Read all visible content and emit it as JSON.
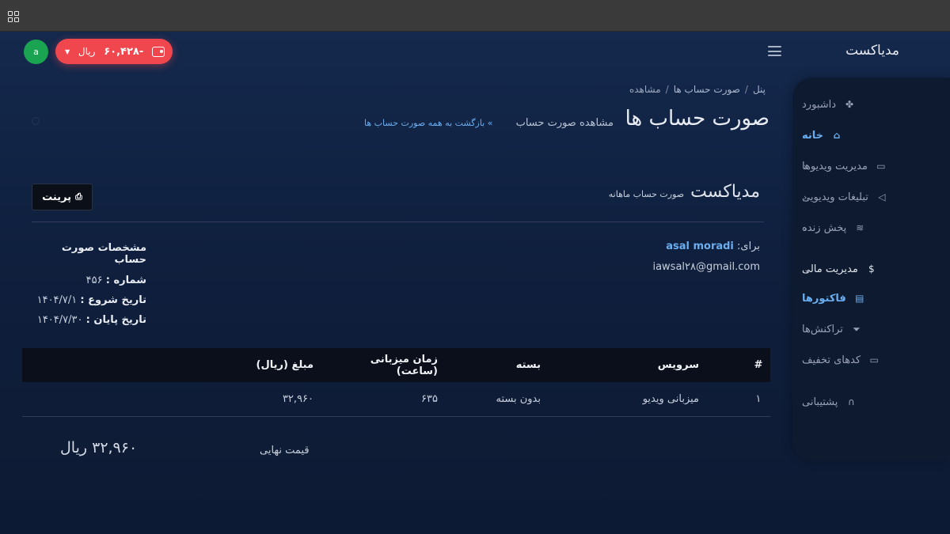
{
  "header": {
    "brand": "مدیاکست",
    "avatar_letter": "a",
    "wallet": {
      "amount": "۶۰,۴۲۸-",
      "currency": "ریال",
      "color": "#f0474f"
    }
  },
  "sidebar": {
    "items": [
      {
        "label": "داشبورد",
        "icon": "puzzle-icon"
      },
      {
        "label": "خانه",
        "icon": "home-icon",
        "active": true
      },
      {
        "label": "مدیریت ویدیوها",
        "icon": "video-icon",
        "chevron": "‹"
      },
      {
        "label": "تبلیغات ویدیویی",
        "icon": "megaphone-icon",
        "chevron": "‹"
      },
      {
        "label": "پخش زنده",
        "icon": "wifi-icon",
        "chevron": "‹"
      },
      {
        "label": "مدیریت مالی",
        "icon": "dollar-icon",
        "chevron": "⌄"
      },
      {
        "label": "فاکتورها",
        "icon": "invoice-icon",
        "active": true
      },
      {
        "label": "تراکنش‌ها",
        "icon": "filter-icon"
      },
      {
        "label": "کدهای تخفیف",
        "icon": "ticket-icon"
      },
      {
        "label": "پشتیبانی",
        "icon": "headset-icon"
      }
    ]
  },
  "breadcrumb": {
    "items": [
      "پنل",
      "صورت حساب ها",
      "مشاهده"
    ],
    "separator": "/"
  },
  "page": {
    "title": "صورت حساب ها",
    "subtitle": "مشاهده صورت حساب",
    "back_link": "» بازگشت به همه صورت حساب ها"
  },
  "invoice": {
    "brand": "مدیاکست",
    "type": "صورت حساب ماهانه",
    "print_label": "پرینت",
    "bill_to_label": "برای:",
    "customer_name": "asal moradi",
    "customer_email": "iawsal۲۸@gmail.com",
    "spec_heading": "مشخصات صورت حساب",
    "number_label": "شماره :",
    "number_value": "۴۵۶",
    "start_label": "تاریخ شروع :",
    "start_value": "۱۴۰۴/۷/۱",
    "end_label": "تاریخ پایان :",
    "end_value": "۱۴۰۴/۷/۳۰",
    "table": {
      "headers": [
        "#",
        "سرویس",
        "بسته",
        "زمان میزبانی (ساعت)",
        "مبلغ (ریال)"
      ],
      "rows": [
        [
          "۱",
          "میزبانی ویدیو",
          "بدون بسته",
          "۶۳۵",
          "۳۲,۹۶۰"
        ]
      ]
    },
    "total_label": "قیمت نهایی",
    "total_value": "۳۲,۹۶۰ ریال"
  },
  "colors": {
    "accent": "#6aaef0",
    "background": "#0f1c36",
    "avatar": "#1aa350"
  }
}
